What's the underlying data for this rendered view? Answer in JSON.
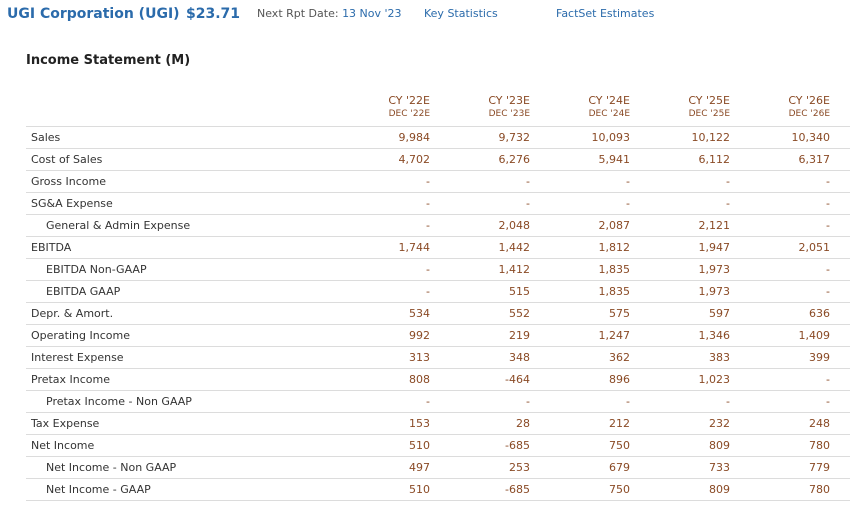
{
  "header": {
    "company": "UGI Corporation (UGI)",
    "price": "$23.71",
    "next_rpt_label": "Next Rpt Date:",
    "next_rpt_date": "13 Nov '23",
    "key_statistics": "Key Statistics",
    "factset_estimates": "FactSet Estimates"
  },
  "section_title": "Income Statement (M)",
  "columns": [
    {
      "cy": "CY '22E",
      "dec": "DEC '22E"
    },
    {
      "cy": "CY '23E",
      "dec": "DEC '23E"
    },
    {
      "cy": "CY '24E",
      "dec": "DEC '24E"
    },
    {
      "cy": "CY '25E",
      "dec": "DEC '25E"
    },
    {
      "cy": "CY '26E",
      "dec": "DEC '26E"
    }
  ],
  "rows": [
    {
      "label": "Sales",
      "values": [
        "9,984",
        "9,732",
        "10,093",
        "10,122",
        "10,340"
      ]
    },
    {
      "label": "Cost of Sales",
      "values": [
        "4,702",
        "6,276",
        "5,941",
        "6,112",
        "6,317"
      ]
    },
    {
      "label": "Gross Income",
      "values": [
        "-",
        "-",
        "-",
        "-",
        "-"
      ]
    },
    {
      "label": "SG&A Expense",
      "values": [
        "-",
        "-",
        "-",
        "-",
        "-"
      ]
    },
    {
      "label": "General & Admin Expense",
      "values": [
        "-",
        "2,048",
        "2,087",
        "2,121",
        "-"
      ]
    },
    {
      "label": "EBITDA",
      "values": [
        "1,744",
        "1,442",
        "1,812",
        "1,947",
        "2,051"
      ]
    },
    {
      "label": "EBITDA Non-GAAP",
      "values": [
        "-",
        "1,412",
        "1,835",
        "1,973",
        "-"
      ]
    },
    {
      "label": "EBITDA GAAP",
      "values": [
        "-",
        "515",
        "1,835",
        "1,973",
        "-"
      ]
    },
    {
      "label": "Depr. & Amort.",
      "values": [
        "534",
        "552",
        "575",
        "597",
        "636"
      ]
    },
    {
      "label": "Operating Income",
      "values": [
        "992",
        "219",
        "1,247",
        "1,346",
        "1,409"
      ]
    },
    {
      "label": "Interest Expense",
      "values": [
        "313",
        "348",
        "362",
        "383",
        "399"
      ]
    },
    {
      "label": "Pretax Income",
      "values": [
        "808",
        "-464",
        "896",
        "1,023",
        "-"
      ]
    },
    {
      "label": "Pretax Income - Non GAAP",
      "values": [
        "-",
        "-",
        "-",
        "-",
        "-"
      ]
    },
    {
      "label": "Tax Expense",
      "values": [
        "153",
        "28",
        "212",
        "232",
        "248"
      ]
    },
    {
      "label": "Net Income",
      "values": [
        "510",
        "-685",
        "750",
        "809",
        "780"
      ]
    },
    {
      "label": "Net Income - Non GAAP",
      "values": [
        "497",
        "253",
        "679",
        "733",
        "779"
      ]
    },
    {
      "label": "Net Income - GAAP",
      "values": [
        "510",
        "-685",
        "750",
        "809",
        "780"
      ]
    }
  ]
}
